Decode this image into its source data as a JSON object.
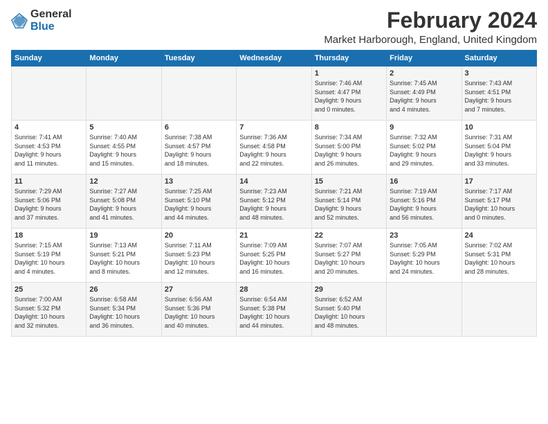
{
  "header": {
    "logo_general": "General",
    "logo_blue": "Blue",
    "title": "February 2024",
    "subtitle": "Market Harborough, England, United Kingdom"
  },
  "days_of_week": [
    "Sunday",
    "Monday",
    "Tuesday",
    "Wednesday",
    "Thursday",
    "Friday",
    "Saturday"
  ],
  "weeks": [
    [
      {
        "day": "",
        "info": ""
      },
      {
        "day": "",
        "info": ""
      },
      {
        "day": "",
        "info": ""
      },
      {
        "day": "",
        "info": ""
      },
      {
        "day": "1",
        "info": "Sunrise: 7:46 AM\nSunset: 4:47 PM\nDaylight: 9 hours\nand 0 minutes."
      },
      {
        "day": "2",
        "info": "Sunrise: 7:45 AM\nSunset: 4:49 PM\nDaylight: 9 hours\nand 4 minutes."
      },
      {
        "day": "3",
        "info": "Sunrise: 7:43 AM\nSunset: 4:51 PM\nDaylight: 9 hours\nand 7 minutes."
      }
    ],
    [
      {
        "day": "4",
        "info": "Sunrise: 7:41 AM\nSunset: 4:53 PM\nDaylight: 9 hours\nand 11 minutes."
      },
      {
        "day": "5",
        "info": "Sunrise: 7:40 AM\nSunset: 4:55 PM\nDaylight: 9 hours\nand 15 minutes."
      },
      {
        "day": "6",
        "info": "Sunrise: 7:38 AM\nSunset: 4:57 PM\nDaylight: 9 hours\nand 18 minutes."
      },
      {
        "day": "7",
        "info": "Sunrise: 7:36 AM\nSunset: 4:58 PM\nDaylight: 9 hours\nand 22 minutes."
      },
      {
        "day": "8",
        "info": "Sunrise: 7:34 AM\nSunset: 5:00 PM\nDaylight: 9 hours\nand 26 minutes."
      },
      {
        "day": "9",
        "info": "Sunrise: 7:32 AM\nSunset: 5:02 PM\nDaylight: 9 hours\nand 29 minutes."
      },
      {
        "day": "10",
        "info": "Sunrise: 7:31 AM\nSunset: 5:04 PM\nDaylight: 9 hours\nand 33 minutes."
      }
    ],
    [
      {
        "day": "11",
        "info": "Sunrise: 7:29 AM\nSunset: 5:06 PM\nDaylight: 9 hours\nand 37 minutes."
      },
      {
        "day": "12",
        "info": "Sunrise: 7:27 AM\nSunset: 5:08 PM\nDaylight: 9 hours\nand 41 minutes."
      },
      {
        "day": "13",
        "info": "Sunrise: 7:25 AM\nSunset: 5:10 PM\nDaylight: 9 hours\nand 44 minutes."
      },
      {
        "day": "14",
        "info": "Sunrise: 7:23 AM\nSunset: 5:12 PM\nDaylight: 9 hours\nand 48 minutes."
      },
      {
        "day": "15",
        "info": "Sunrise: 7:21 AM\nSunset: 5:14 PM\nDaylight: 9 hours\nand 52 minutes."
      },
      {
        "day": "16",
        "info": "Sunrise: 7:19 AM\nSunset: 5:16 PM\nDaylight: 9 hours\nand 56 minutes."
      },
      {
        "day": "17",
        "info": "Sunrise: 7:17 AM\nSunset: 5:17 PM\nDaylight: 10 hours\nand 0 minutes."
      }
    ],
    [
      {
        "day": "18",
        "info": "Sunrise: 7:15 AM\nSunset: 5:19 PM\nDaylight: 10 hours\nand 4 minutes."
      },
      {
        "day": "19",
        "info": "Sunrise: 7:13 AM\nSunset: 5:21 PM\nDaylight: 10 hours\nand 8 minutes."
      },
      {
        "day": "20",
        "info": "Sunrise: 7:11 AM\nSunset: 5:23 PM\nDaylight: 10 hours\nand 12 minutes."
      },
      {
        "day": "21",
        "info": "Sunrise: 7:09 AM\nSunset: 5:25 PM\nDaylight: 10 hours\nand 16 minutes."
      },
      {
        "day": "22",
        "info": "Sunrise: 7:07 AM\nSunset: 5:27 PM\nDaylight: 10 hours\nand 20 minutes."
      },
      {
        "day": "23",
        "info": "Sunrise: 7:05 AM\nSunset: 5:29 PM\nDaylight: 10 hours\nand 24 minutes."
      },
      {
        "day": "24",
        "info": "Sunrise: 7:02 AM\nSunset: 5:31 PM\nDaylight: 10 hours\nand 28 minutes."
      }
    ],
    [
      {
        "day": "25",
        "info": "Sunrise: 7:00 AM\nSunset: 5:32 PM\nDaylight: 10 hours\nand 32 minutes."
      },
      {
        "day": "26",
        "info": "Sunrise: 6:58 AM\nSunset: 5:34 PM\nDaylight: 10 hours\nand 36 minutes."
      },
      {
        "day": "27",
        "info": "Sunrise: 6:56 AM\nSunset: 5:36 PM\nDaylight: 10 hours\nand 40 minutes."
      },
      {
        "day": "28",
        "info": "Sunrise: 6:54 AM\nSunset: 5:38 PM\nDaylight: 10 hours\nand 44 minutes."
      },
      {
        "day": "29",
        "info": "Sunrise: 6:52 AM\nSunset: 5:40 PM\nDaylight: 10 hours\nand 48 minutes."
      },
      {
        "day": "",
        "info": ""
      },
      {
        "day": "",
        "info": ""
      }
    ]
  ]
}
